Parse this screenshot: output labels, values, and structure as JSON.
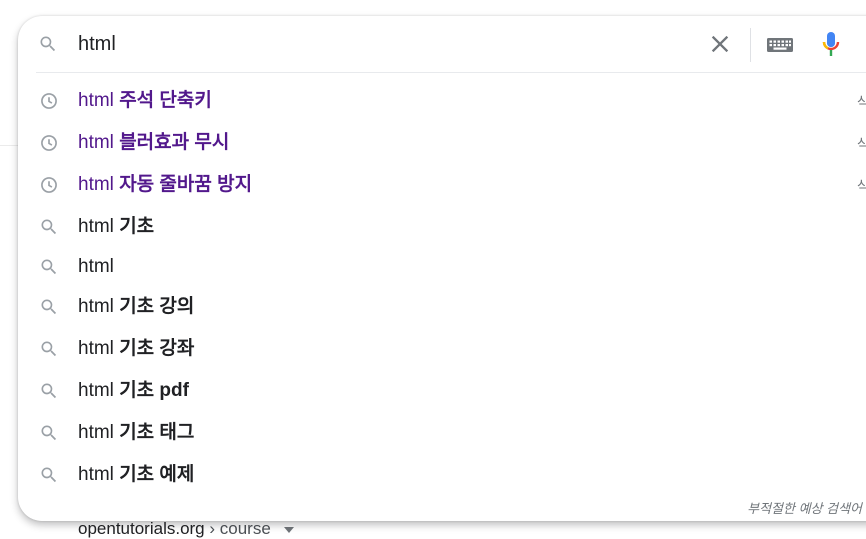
{
  "search": {
    "query": "html",
    "clear_label": "Clear",
    "keyboard_label": "Keyboard",
    "mic_label": "Voice search"
  },
  "suggestions": [
    {
      "type": "history",
      "prefix": "html",
      "completion": "주석 단축키",
      "edge": "삭"
    },
    {
      "type": "history",
      "prefix": "html",
      "completion": "블러효과 무시",
      "edge": "삭"
    },
    {
      "type": "history",
      "prefix": "html",
      "completion": "자동 줄바꿈 방지",
      "edge": "삭"
    },
    {
      "type": "search",
      "prefix": "html",
      "completion": "기초",
      "edge": ""
    },
    {
      "type": "search",
      "prefix": "html",
      "completion": "",
      "edge": ""
    },
    {
      "type": "search",
      "prefix": "html",
      "completion": "기초 강의",
      "edge": ""
    },
    {
      "type": "search",
      "prefix": "html",
      "completion": "기초 강좌",
      "edge": ""
    },
    {
      "type": "search",
      "prefix": "html",
      "completion": "기초 pdf",
      "edge": ""
    },
    {
      "type": "search",
      "prefix": "html",
      "completion": "기초 태그",
      "edge": ""
    },
    {
      "type": "search",
      "prefix": "html",
      "completion": "기초 예제",
      "edge": ""
    }
  ],
  "report_label": "부적절한 예상 검색어",
  "background_result": {
    "domain": "opentutorials.org",
    "path": "› course"
  },
  "colors": {
    "history_text": "#52188c",
    "icon_gray": "#9aa0a6",
    "mic_blue": "#4285f4",
    "mic_red": "#ea4335",
    "mic_yellow": "#fbbc04",
    "mic_green": "#34a853"
  }
}
